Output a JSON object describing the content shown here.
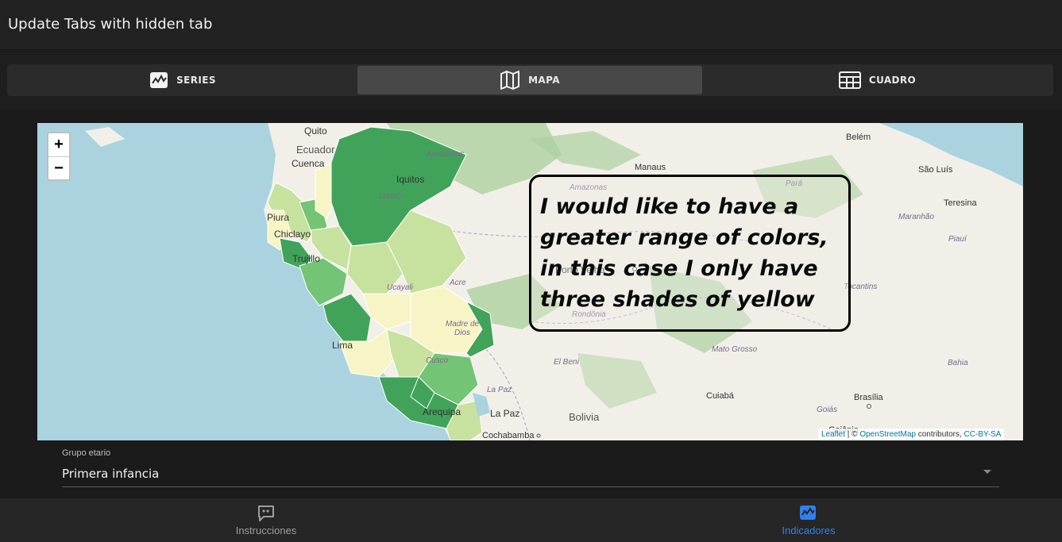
{
  "app": {
    "title": "Update Tabs with hidden tab"
  },
  "tabs": [
    {
      "label": "SERIES",
      "icon": "chart-icon",
      "active": false
    },
    {
      "label": "MAPA",
      "icon": "map-icon",
      "active": true
    },
    {
      "label": "CUADRO",
      "icon": "table-icon",
      "active": false
    }
  ],
  "map": {
    "zoom_in": "+",
    "zoom_out": "−",
    "labels": {
      "quito": "Quito",
      "ecuador": "Ecuador",
      "cuenca": "Cuenca",
      "piura": "Piura",
      "chiclayo": "Chiclayo",
      "trujillo": "Trujillo",
      "lima": "Lima",
      "iquitos": "Iquitos",
      "loreto": "Loreto",
      "amazonas_co": "Amazonas",
      "ucayali": "Ucayali",
      "madre_de_dios": "Madre de Dios",
      "cusco": "Cusco",
      "arequipa": "Arequipa",
      "la_paz_region": "La Paz",
      "la_paz": "La Paz",
      "cochabamba": "Cochabamba",
      "bolivia": "Bolivia",
      "el_beni": "El Beni",
      "acre": "Acre",
      "porto_velho": "Porto Velho",
      "rondonia": "Rondônia",
      "manaus": "Manaus",
      "amazonas_br": "Amazonas",
      "para": "Pará",
      "belem": "Belém",
      "sao_luis": "São Luís",
      "teresina": "Teresina",
      "maranhao": "Maranhão",
      "piaui": "Piauí",
      "tocantins": "Tocantins",
      "bahia": "Bahia",
      "mato_grosso": "Mato Grosso",
      "cuiaba": "Cuiabá",
      "brasilia": "Brasília",
      "goias": "Goiás",
      "goiania": "Goiânia"
    },
    "attribution": {
      "leaflet": "Leaflet",
      "sep": " | © ",
      "osm": "OpenStreetMap",
      "contrib": " contributors, ",
      "license": "CC-BY-SA"
    },
    "colors": {
      "dark_green": "#41a35a",
      "mid_green": "#74c476",
      "light_green": "#c7e29f",
      "yellow": "#f7f5c5",
      "water": "#aad3df",
      "land": "#f2efe9",
      "forest": "#add19e"
    }
  },
  "annotation": {
    "text": "I would like to have a greater range of colors, in this case I only have three shades of yellow"
  },
  "filter": {
    "label": "Grupo etario",
    "value": "Primera infancia"
  },
  "bottom_nav": [
    {
      "label": "Instrucciones",
      "icon": "chat-quote-icon",
      "active": false,
      "color": "#9e9e9e"
    },
    {
      "label": "Indicadores",
      "icon": "chart-icon",
      "active": true,
      "color": "#2f80ed"
    }
  ]
}
